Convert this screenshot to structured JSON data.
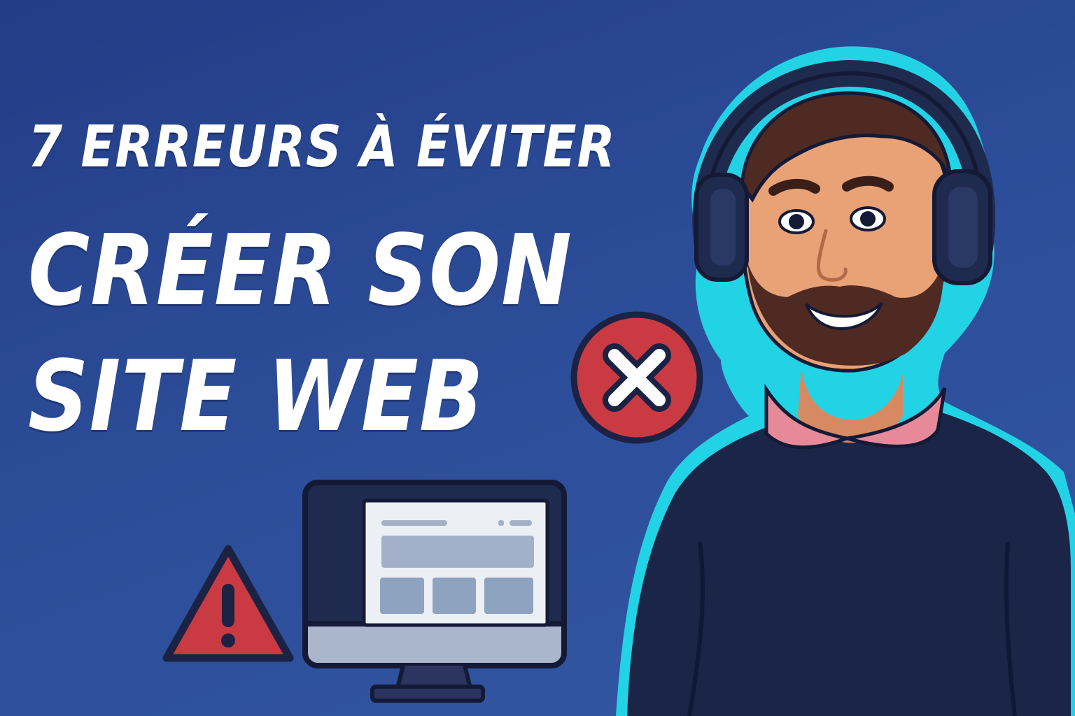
{
  "headline": {
    "line1": "7 ERREURS À ÉVITER",
    "line2": "CRÉER SON",
    "line3": "SITE WEB"
  },
  "icons": {
    "error": "close-circle-icon",
    "warning": "warning-triangle-icon",
    "monitor": "desktop-monitor-icon"
  },
  "colors": {
    "background": "#2c4c98",
    "text": "#ffffff",
    "error_red": "#c93a43",
    "outline_cyan": "#22d3e6",
    "sweater": "#1a2548",
    "shirt": "#e68a9a"
  }
}
